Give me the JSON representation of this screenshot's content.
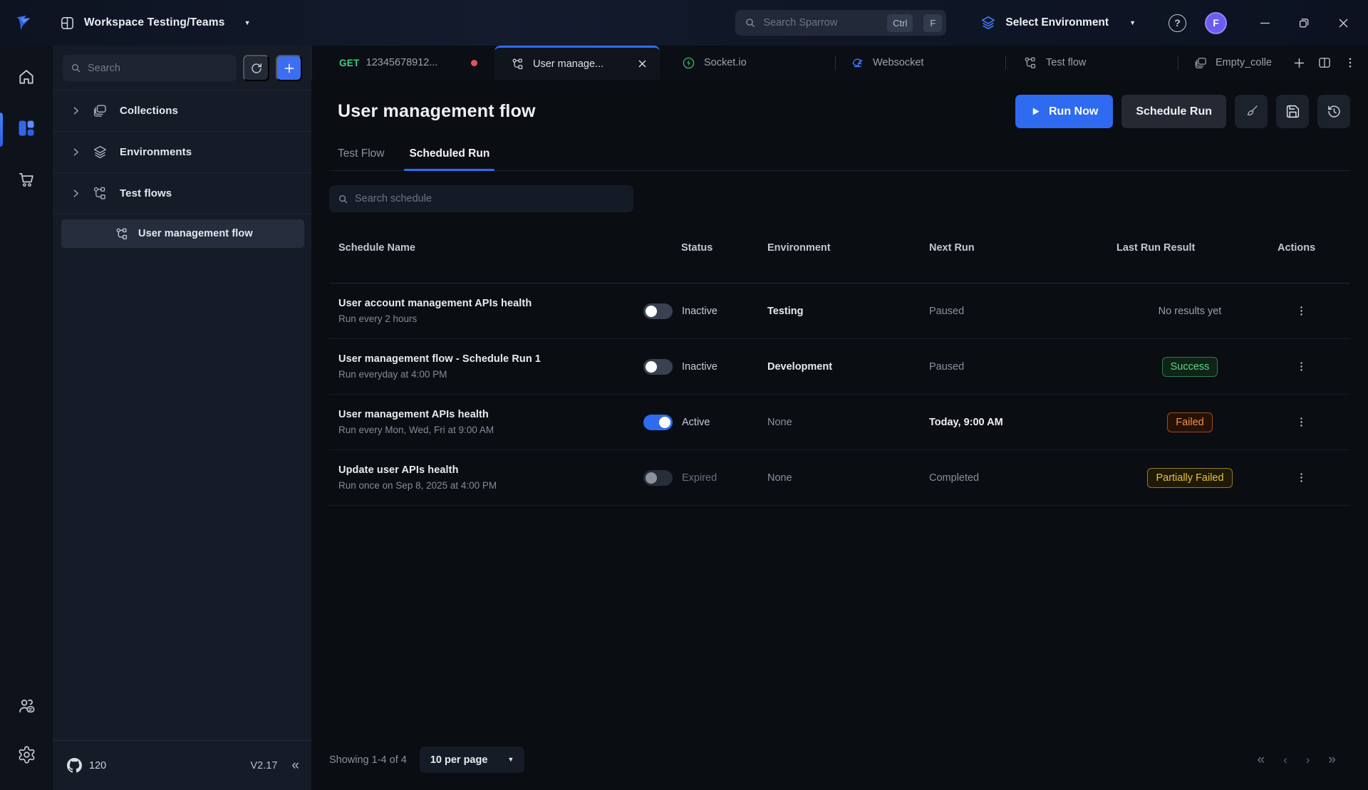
{
  "colors": {
    "accent_blue": "#2F6CF0",
    "success_green": "#65D48B",
    "failed_orange": "#F0914C",
    "partial_yellow": "#E4C340",
    "method_get_green": "#3FD183",
    "unsaved_dot_red": "#E05555",
    "avatar_purple": "#6C5CF0"
  },
  "topbar": {
    "workspace_label": "Workspace Testing/Teams",
    "search_placeholder": "Search Sparrow",
    "shortcut_keys": [
      "Ctrl",
      "F"
    ],
    "environment_selector": "Select Environment",
    "avatar_initial": "F",
    "help_glyph": "?"
  },
  "sidebar": {
    "search_placeholder": "Search",
    "sections": [
      {
        "label": "Collections"
      },
      {
        "label": "Environments"
      },
      {
        "label": "Test flows"
      }
    ],
    "selected_item": "User management flow",
    "github_count": "120",
    "version": "V2.17",
    "collapse_glyph": "«"
  },
  "tabbar": {
    "request_tab": {
      "method": "GET",
      "label": "12345678912..."
    },
    "active_tab": {
      "label": "User manage..."
    },
    "socket_tab": {
      "label": "Socket.io"
    },
    "websocket_tab": {
      "label": "Websocket"
    },
    "testflow_tab": {
      "label": "Test flow"
    },
    "collection_tab": {
      "label": "Empty_colle"
    }
  },
  "page": {
    "title": "User management flow",
    "run_now_label": "Run Now",
    "schedule_run_label": "Schedule Run",
    "tab_test_flow": "Test Flow",
    "tab_scheduled_run": "Scheduled Run",
    "search_placeholder": "Search schedule"
  },
  "table": {
    "headers": [
      "Schedule Name",
      "Status",
      "Environment",
      "Next Run",
      "Last Run Result",
      "Actions"
    ],
    "rows": [
      {
        "name": "User account management APIs health",
        "schedule": "Run every 2 hours",
        "status": "Inactive",
        "environment": "Testing",
        "next_run": "Paused",
        "result": "No results yet"
      },
      {
        "name": "User management flow - Schedule Run 1",
        "schedule": "Run everyday at 4:00 PM",
        "status": "Inactive",
        "environment": "Development",
        "next_run": "Paused",
        "result": "Success"
      },
      {
        "name": "User management APIs health",
        "schedule": "Run every Mon, Wed, Fri  at 9:00 AM",
        "status": "Active",
        "environment": "None",
        "next_run": "Today, 9:00 AM",
        "result": "Failed"
      },
      {
        "name": "Update user APIs health",
        "schedule": "Run once on Sep 8, 2025 at 4:00 PM",
        "status": "Expired",
        "environment": "None",
        "next_run": "Completed",
        "result": "Partially Failed"
      }
    ]
  },
  "footer": {
    "showing": "Showing 1-4 of 4",
    "per_page": "10 per page",
    "pagination": [
      "«",
      "‹",
      "›",
      "»"
    ],
    "caret_glyph": "▼"
  }
}
